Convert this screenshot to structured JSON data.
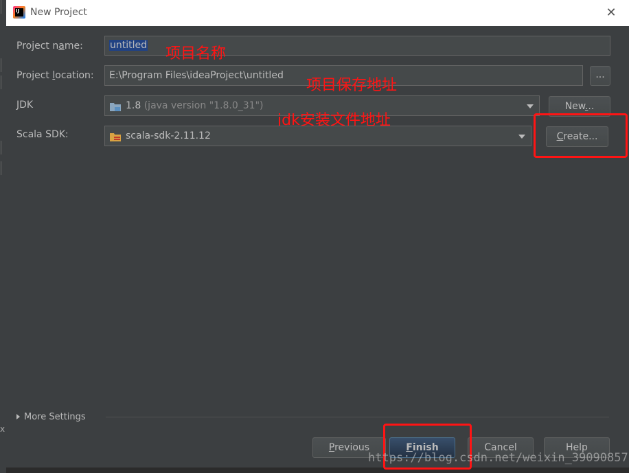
{
  "window": {
    "title": "New Project",
    "logo_text": "IJ"
  },
  "fields": {
    "project_name": {
      "label": "Project name:",
      "value": "untitled"
    },
    "project_location": {
      "label": "Project location:",
      "value": "E:\\Program Files\\ideaProject\\untitled",
      "browse_label": "..."
    },
    "jdk": {
      "label": "JDK",
      "version": "1.8",
      "detail": "(java version \"1.8.0_31\")",
      "new_label": "New..."
    },
    "scala_sdk": {
      "label": "Scala SDK:",
      "value": "scala-sdk-2.11.12",
      "create_label": "Create..."
    }
  },
  "annotations": {
    "name_note": "项目名称",
    "location_note": "项目保存地址",
    "jdk_note": "jdk安装文件地址"
  },
  "more_settings_label": "More Settings",
  "buttons": {
    "previous": "Previous",
    "finish": "Finish",
    "cancel": "Cancel",
    "help": "Help"
  },
  "watermark": "https://blog.csdn.net/weixin_39090857",
  "side_text": "x",
  "colors": {
    "annotation": "#ff1414",
    "dialog_bg": "#3c3f41",
    "selection": "#214283"
  }
}
